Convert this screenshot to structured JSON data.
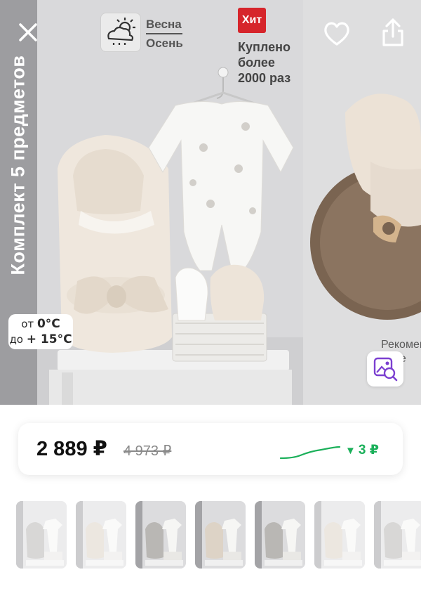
{
  "gallery": {
    "vertical_title": "Комплект 5 предметов",
    "temperature": {
      "line1_prefix": "от ",
      "line1_value": "0°C",
      "line2_prefix": "до ",
      "line2_value": "+ 15°C"
    },
    "season": {
      "line1": "Весна",
      "line2": "Осень",
      "icon": "weather-cloud-sun-icon"
    },
    "hit_badge": "Хит",
    "sold": {
      "line1": "Куплено",
      "line2": "более",
      "line3": "2000 раз"
    },
    "next_photo_caption": {
      "line1": "Рекомен",
      "line2": "епле"
    }
  },
  "actions": {
    "back_icon": "close-icon",
    "favorite_icon": "heart-icon",
    "share_icon": "share-icon",
    "visual_search_icon": "image-search-icon"
  },
  "price": {
    "current": "2 889 ₽",
    "old": "4 973 ₽",
    "change": "3 ₽",
    "change_arrow": "▼",
    "accent_color": "#1bb05a"
  },
  "thumbnails": {
    "count": 7,
    "active_indices": [
      2,
      3,
      4
    ]
  }
}
